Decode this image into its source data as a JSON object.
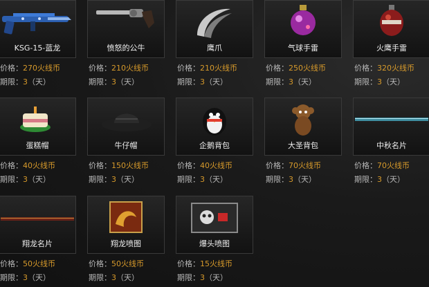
{
  "labels": {
    "price_prefix": "价格：",
    "currency": "火线币",
    "term_prefix": "期限：",
    "term_open": "（",
    "term_unit": "天",
    "term_close": "）"
  },
  "colors": {
    "accent": "#d79a2b",
    "text": "#b9b9b9",
    "name": "#f0f0f0",
    "card_border": "#3a3a3a"
  },
  "items": [
    {
      "name": "KSG-15-蓝龙",
      "price": "270",
      "days": "3",
      "icon": "shotgun-blue-dragon-icon"
    },
    {
      "name": "愤怒的公牛",
      "price": "210",
      "days": "3",
      "icon": "revolver-icon"
    },
    {
      "name": "鹰爪",
      "price": "210",
      "days": "3",
      "icon": "karambit-claw-icon"
    },
    {
      "name": "气球手雷",
      "price": "250",
      "days": "3",
      "icon": "balloon-grenade-icon"
    },
    {
      "name": "火鹰手雷",
      "price": "320",
      "days": "3",
      "icon": "fire-hawk-grenade-icon"
    },
    {
      "name": "蛋糕帽",
      "price": "40",
      "days": "3",
      "icon": "cake-hat-icon"
    },
    {
      "name": "牛仔帽",
      "price": "150",
      "days": "3",
      "icon": "cowboy-hat-icon"
    },
    {
      "name": "企鹅背包",
      "price": "40",
      "days": "3",
      "icon": "penguin-backpack-icon"
    },
    {
      "name": "大圣背包",
      "price": "70",
      "days": "3",
      "icon": "monkey-backpack-icon"
    },
    {
      "name": "中秋名片",
      "price": "70",
      "days": "3",
      "icon": "midautumn-namecard-icon"
    },
    {
      "name": "翔龙名片",
      "price": "50",
      "days": "3",
      "icon": "dragon-namecard-icon"
    },
    {
      "name": "翔龙喷图",
      "price": "50",
      "days": "3",
      "icon": "dragon-spray-icon"
    },
    {
      "name": "爆头喷图",
      "price": "15",
      "days": "3",
      "icon": "headshot-spray-icon"
    }
  ]
}
